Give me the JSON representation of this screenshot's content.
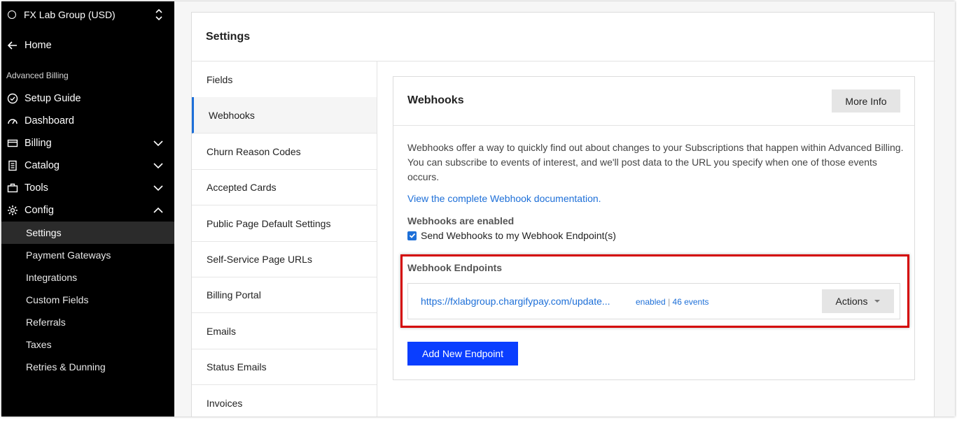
{
  "sidebar": {
    "org_name": "FX Lab Group (USD)",
    "home": "Home",
    "section": "Advanced Billing",
    "items": [
      {
        "label": "Setup Guide",
        "icon": "check-circle-icon"
      },
      {
        "label": "Dashboard",
        "icon": "gauge-icon"
      },
      {
        "label": "Billing",
        "icon": "card-icon",
        "expandable": true
      },
      {
        "label": "Catalog",
        "icon": "document-icon",
        "expandable": true
      },
      {
        "label": "Tools",
        "icon": "toolbox-icon",
        "expandable": true
      },
      {
        "label": "Config",
        "icon": "gear-icon",
        "expanded": true
      }
    ],
    "config_sub": [
      "Settings",
      "Payment Gateways",
      "Integrations",
      "Custom Fields",
      "Referrals",
      "Taxes",
      "Retries & Dunning"
    ]
  },
  "settings": {
    "title": "Settings",
    "menu": [
      "Fields",
      "Webhooks",
      "Churn Reason Codes",
      "Accepted Cards",
      "Public Page Default Settings",
      "Self-Service Page URLs",
      "Billing Portal",
      "Emails",
      "Status Emails",
      "Invoices"
    ]
  },
  "webhooks": {
    "title": "Webhooks",
    "more_info": "More Info",
    "description": "Webhooks offer a way to quickly find out about changes to your Subscriptions that happen within Advanced Billing. You can subscribe to events of interest, and we'll post data to the URL you specify when one of those events occurs.",
    "doc_link": "View the complete Webhook documentation.",
    "enabled_label": "Webhooks are enabled",
    "send_checkbox": "Send Webhooks to my Webhook Endpoint(s)",
    "endpoints_label": "Webhook Endpoints",
    "endpoint": {
      "url": "https://fxlabgroup.chargifypay.com/update...",
      "status": "enabled",
      "events": "46 events",
      "actions": "Actions"
    },
    "add_button": "Add New Endpoint"
  },
  "colors": {
    "accent": "#1d6fd8",
    "primary_button": "#0a3eff",
    "highlight": "#d40000"
  }
}
